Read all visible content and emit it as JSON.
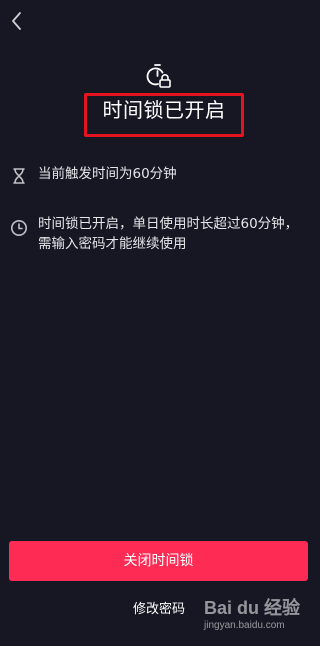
{
  "header": {
    "back_icon": "chevron-left-icon"
  },
  "hero": {
    "icon": "timer-lock-icon",
    "title": "时间锁已开启",
    "highlight_color": "#e3141f"
  },
  "info_rows": [
    {
      "icon": "hourglass-icon",
      "text": "当前触发时间为60分钟"
    },
    {
      "icon": "clock-icon",
      "line1": "时间锁已开启，单日使用时长超过60分钟，",
      "line2": "需输入密码才能继续使用"
    }
  ],
  "actions": {
    "primary_label": "关闭时间锁",
    "primary_color": "#fe2c55",
    "secondary_label": "修改密码"
  },
  "watermark": {
    "brand": "Bai du 经验",
    "url": "jingyan.baidu.com"
  }
}
